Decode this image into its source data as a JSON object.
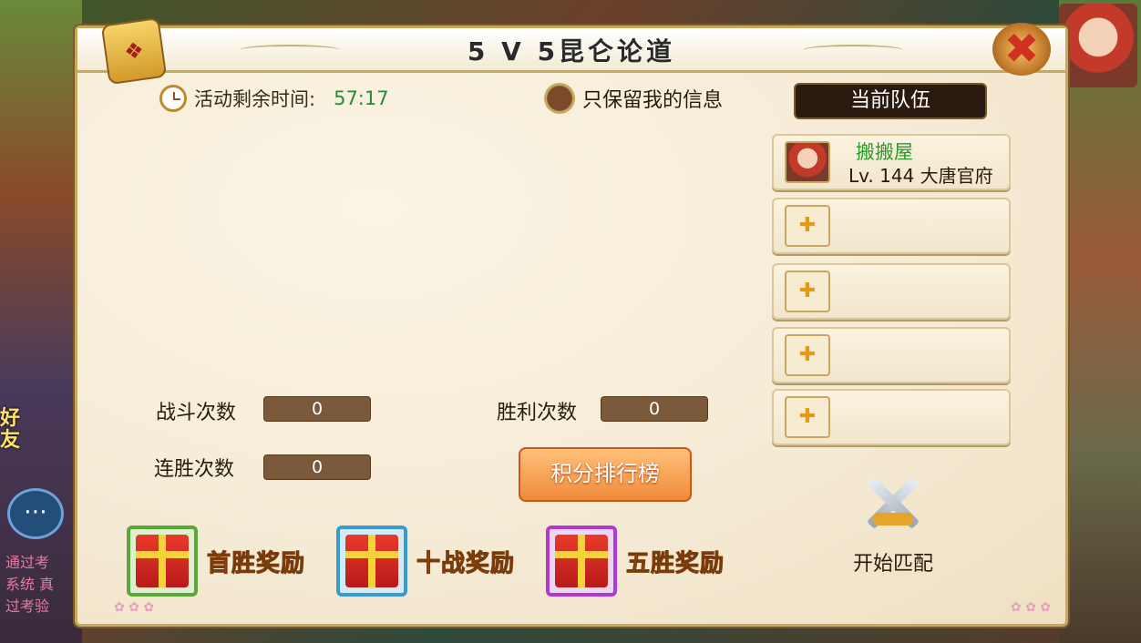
{
  "background": {
    "friend_label": [
      "好",
      "友"
    ],
    "chat_icon": "chat-bubble-icon",
    "ticker_lines": [
      "通过考",
      "系统 真",
      "过考验"
    ]
  },
  "window": {
    "title": "5 V 5昆仑论道",
    "scroll_icon": "scroll-icon",
    "close_icon": "close-icon"
  },
  "timer": {
    "label": "活动剩余时间:",
    "value": "57:17"
  },
  "filter": {
    "label": "只保留我的信息"
  },
  "team": {
    "header": "当前队伍",
    "member": {
      "name": "搬搬屋",
      "info": "Lv. 144  大唐官府"
    },
    "empty_slot_icon": "plus-icon"
  },
  "stats": {
    "battles_label": "战斗次数",
    "battles_value": "0",
    "wins_label": "胜利次数",
    "wins_value": "0",
    "streak_label": "连胜次数",
    "streak_value": "0"
  },
  "ranking_button": "积分排行榜",
  "rewards": [
    {
      "label": "首胜奖励",
      "frame_color": "#5aa83a"
    },
    {
      "label": "十战奖励",
      "frame_color": "#3a9ad0"
    },
    {
      "label": "五胜奖励",
      "frame_color": "#b03ad0"
    }
  ],
  "match": {
    "label": "开始匹配",
    "icon": "crossed-swords-icon"
  }
}
